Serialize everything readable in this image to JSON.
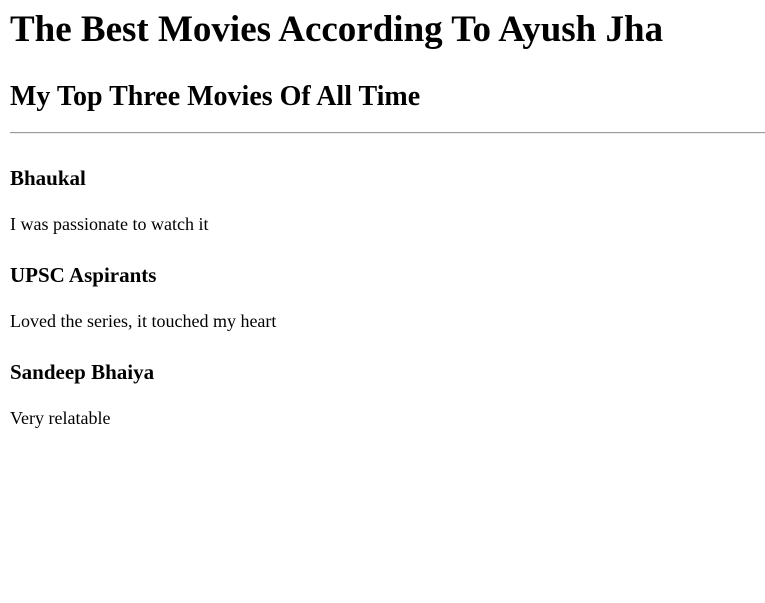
{
  "page": {
    "title": "The Best Movies According To Ayush Jha",
    "subtitle": "My Top Three Movies Of All Time"
  },
  "movies": [
    {
      "name": "Bhaukal",
      "comment": "I was passionate to watch it"
    },
    {
      "name": "UPSC Aspirants",
      "comment": "Loved the series, it touched my heart"
    },
    {
      "name": "Sandeep Bhaiya",
      "comment": "Very relatable"
    }
  ]
}
